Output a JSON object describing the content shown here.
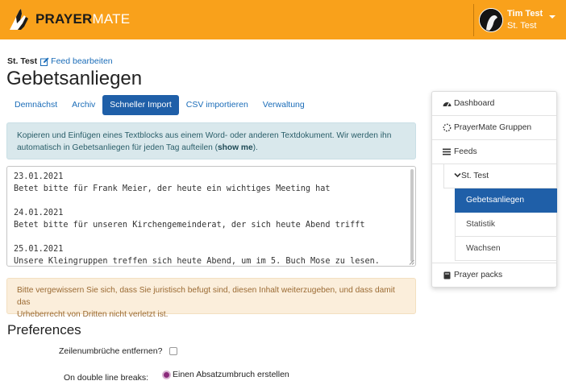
{
  "header": {
    "brand_bold": "PRAYER",
    "brand_light": "MATE",
    "user_name": "Tim Test",
    "user_feed": "St. Test"
  },
  "breadcrumb": {
    "owner": "St. Test",
    "edit_label": "Feed bearbeiten"
  },
  "page_title": "Gebetsanliegen",
  "tabs": [
    {
      "label": "Demnächst",
      "active": false
    },
    {
      "label": "Archiv",
      "active": false
    },
    {
      "label": "Schneller Import",
      "active": true
    },
    {
      "label": "CSV importieren",
      "active": false
    },
    {
      "label": "Verwaltung",
      "active": false
    }
  ],
  "info": {
    "text_line1": "Kopieren und Einfügen eines Textblocks aus einem Word- oder anderen Textdokument. Wir werden ihn",
    "text_line2_pre": "automatisch in Gebetsanliegen für jeden Tag aufteilen (",
    "show_me": "show me",
    "text_line2_post": ")."
  },
  "import_text": "23.01.2021\nBetet bitte für Frank Meier, der heute ein wichtiges Meeting hat\n\n24.01.2021\nBetet bitte für unseren Kirchengemeinderat, der sich heute Abend trifft\n\n25.01.2021\nUnsere Kleingruppen treffen sich heute Abend, um im 5. Buch Mose zu lesen.",
  "warning": {
    "line1": "Bitte vergewissern Sie sich, dass Sie juristisch befugt sind, diesen Inhalt weiterzugeben, und dass damit das",
    "line2": "Urheberrecht von Dritten nicht verletzt ist."
  },
  "preferences": {
    "title": "Preferences",
    "remove_linebreaks_label": "Zeilenumbrüche entfernen?",
    "remove_linebreaks_checked": false,
    "double_breaks_label": "On double line breaks:",
    "double_breaks_option": "Einen Absatzumbruch erstellen"
  },
  "sidebar": {
    "dashboard": "Dashboard",
    "groups": "PrayerMate Gruppen",
    "feeds": "Feeds",
    "feed_name": "St. Test",
    "sub_items": [
      {
        "label": "Gebetsanliegen",
        "active": true
      },
      {
        "label": "Statistik",
        "active": false
      },
      {
        "label": "Wachsen",
        "active": false
      }
    ],
    "prayer_packs": "Prayer packs"
  },
  "colors": {
    "header_bg": "#f9a11b",
    "accent_blue": "#1f5fa8",
    "link_blue": "#1a6cb8"
  }
}
